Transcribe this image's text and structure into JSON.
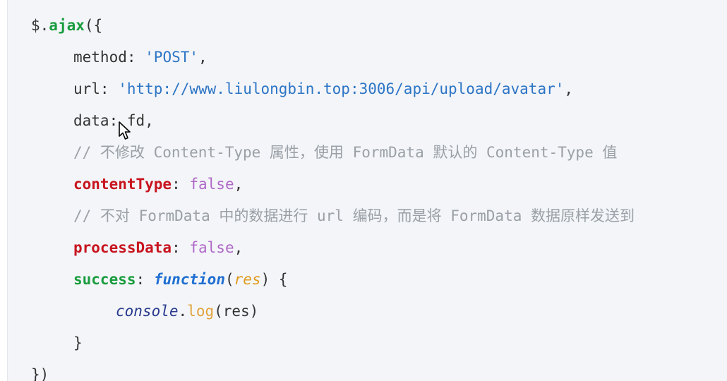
{
  "code_lines": [
    [
      {
        "text": "$.",
        "kind": "plain"
      },
      {
        "text": "ajax",
        "kind": "method"
      },
      {
        "text": "({",
        "kind": "plain"
      }
    ],
    [
      {
        "text": "method: ",
        "kind": "plain"
      },
      {
        "text": "'POST'",
        "kind": "string"
      },
      {
        "text": ",",
        "kind": "plain"
      }
    ],
    [
      {
        "text": "url: ",
        "kind": "plain"
      },
      {
        "text": "'http://www.liulongbin.top:3006/api/upload/avatar'",
        "kind": "string"
      },
      {
        "text": ",",
        "kind": "plain"
      }
    ],
    [
      {
        "text": "data: fd,",
        "kind": "plain"
      }
    ],
    [
      {
        "text": "// 不修改 Content-Type 属性，使用 FormData 默认的 Content-Type 值",
        "kind": "comment"
      }
    ],
    [
      {
        "text": "contentType",
        "kind": "prop-red"
      },
      {
        "text": ": ",
        "kind": "plain"
      },
      {
        "text": "false",
        "kind": "bool"
      },
      {
        "text": ",",
        "kind": "plain"
      }
    ],
    [
      {
        "text": "// 不对 FormData 中的数据进行 url 编码，而是将 FormData 数据原样发送到",
        "kind": "comment"
      }
    ],
    [
      {
        "text": "processData",
        "kind": "prop-red"
      },
      {
        "text": ": ",
        "kind": "plain"
      },
      {
        "text": "false",
        "kind": "bool"
      },
      {
        "text": ",",
        "kind": "plain"
      }
    ],
    [
      {
        "text": "success",
        "kind": "prop-green"
      },
      {
        "text": ": ",
        "kind": "plain"
      },
      {
        "text": "function",
        "kind": "keyword"
      },
      {
        "text": "(",
        "kind": "plain"
      },
      {
        "text": "res",
        "kind": "param"
      },
      {
        "text": ") {",
        "kind": "plain"
      }
    ],
    [
      {
        "text": "console",
        "kind": "console"
      },
      {
        "text": ".",
        "kind": "plain"
      },
      {
        "text": "log",
        "kind": "log"
      },
      {
        "text": "(res)",
        "kind": "plain"
      }
    ],
    [
      {
        "text": "}",
        "kind": "plain"
      }
    ],
    [
      {
        "text": "})",
        "kind": "plain"
      }
    ]
  ],
  "colors": {
    "background": "#f3f5f9",
    "method": "#1a9c3e",
    "string": "#2d75c5",
    "comment": "#9aa0a6",
    "property_red": "#c8141e",
    "keyword": "#1f6fd1",
    "boolean": "#b068c8",
    "parameter": "#e09a1e"
  },
  "cursor_icon": "mouse-pointer-icon"
}
